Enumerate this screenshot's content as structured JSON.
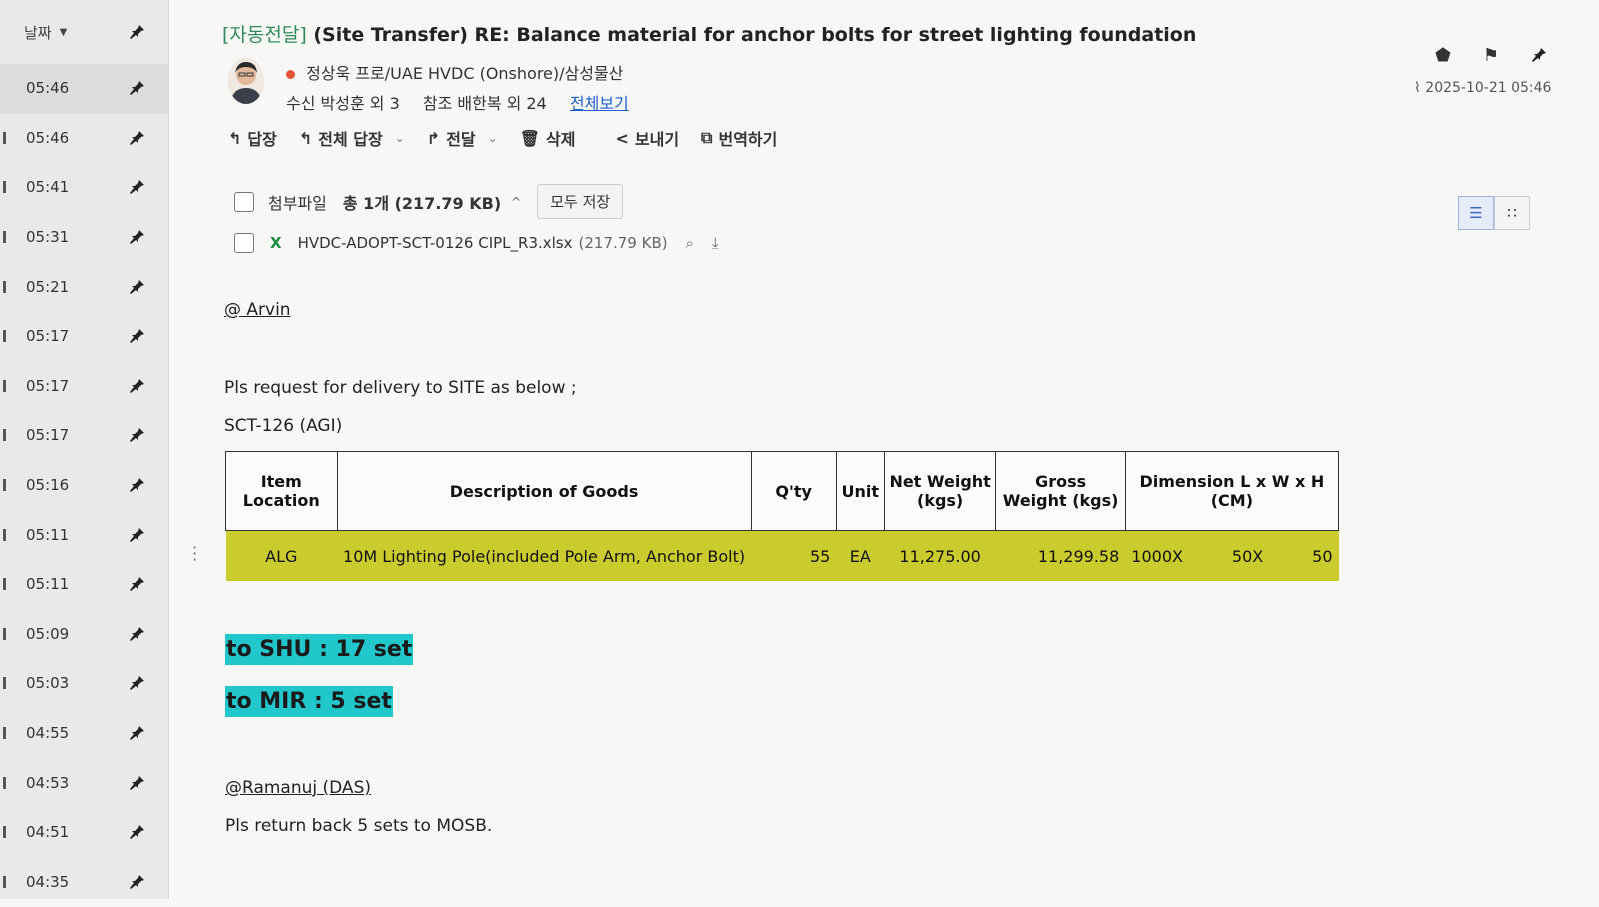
{
  "list": {
    "sort_label": "날짜",
    "times": [
      "05:46",
      "05:46",
      "05:41",
      "05:31",
      "05:21",
      "05:17",
      "05:17",
      "05:17",
      "05:16",
      "05:11",
      "05:11",
      "05:09",
      "05:03",
      "04:55",
      "04:53",
      "04:51",
      "04:35"
    ]
  },
  "mail": {
    "subject_tag": "[자동전달]",
    "subject": "(Site Transfer) RE: Balance material for anchor bolts for street lighting foundation",
    "sender": "정상욱 프로/UAE HVDC (Onshore)/삼성물산",
    "to": "수신  박성훈 외 3",
    "cc": "참조  배한복 외 24",
    "view_all": "전체보기",
    "date": "2025-10-21 05:46"
  },
  "toolbar": {
    "reply": "답장",
    "reply_all": "전체 답장",
    "forward": "전달",
    "delete": "삭제",
    "send": "보내기",
    "translate": "번역하기"
  },
  "attachments": {
    "label": "첨부파일",
    "summary": "총 1개  (217.79 KB)",
    "save_all": "모두 저장",
    "file_name": "HVDC-ADOPT-SCT-0126 CIPL_R3.xlsx",
    "file_size": "(217.79 KB)"
  },
  "body": {
    "mention": "@ Arvin",
    "line1": "Pls request for delivery to SITE as below ;",
    "line2": "SCT-126 (AGI)",
    "highlight1": "to SHU : 17 set",
    "highlight2": "to MIR : 5 set",
    "mention2": "@Ramanuj (DAS)",
    "line3": "Pls return back 5 sets to MOSB."
  },
  "table": {
    "headers": {
      "item_location": "Item Location",
      "description": "Description of Goods",
      "qty": "Q'ty",
      "unit": "Unit",
      "net_weight": "Net Weight (kgs)",
      "gross_weight": "Gross Weight (kgs)",
      "dimension": "Dimension L x W x H (CM)"
    },
    "row": {
      "location": "ALG",
      "description": "10M Lighting Pole(included Pole Arm, Anchor Bolt)",
      "qty": "55",
      "unit": "EA",
      "net_weight": "11,275.00",
      "gross_weight": "11,299.58",
      "dim_l": "1000X",
      "dim_w": "50X",
      "dim_h": "50"
    }
  }
}
